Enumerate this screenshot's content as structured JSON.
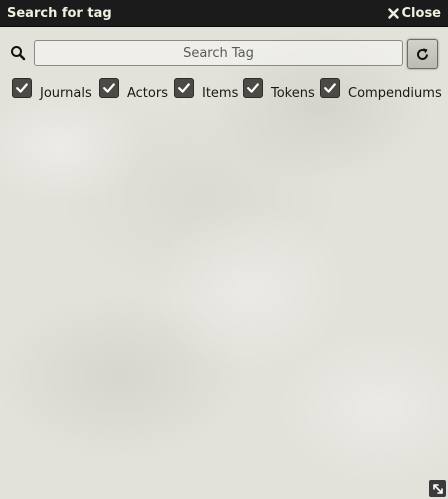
{
  "window": {
    "title": "Search for tag",
    "close_label": "Close"
  },
  "search": {
    "placeholder": "Search Tag",
    "value": ""
  },
  "filters": [
    {
      "label": "Journals",
      "checked": true
    },
    {
      "label": "Actors",
      "checked": true
    },
    {
      "label": "Items",
      "checked": true
    },
    {
      "label": "Tokens",
      "checked": true
    },
    {
      "label": "Compendiums",
      "checked": true
    }
  ],
  "icons": {
    "search": "search-icon",
    "refresh": "refresh-icon",
    "close": "close-icon",
    "checkmark": "checkmark-icon",
    "resize": "resize-icon"
  },
  "colors": {
    "header_bg": "#1b1b1b",
    "content_bg": "#e2e1da",
    "checkbox_bg": "#4b4a44"
  }
}
